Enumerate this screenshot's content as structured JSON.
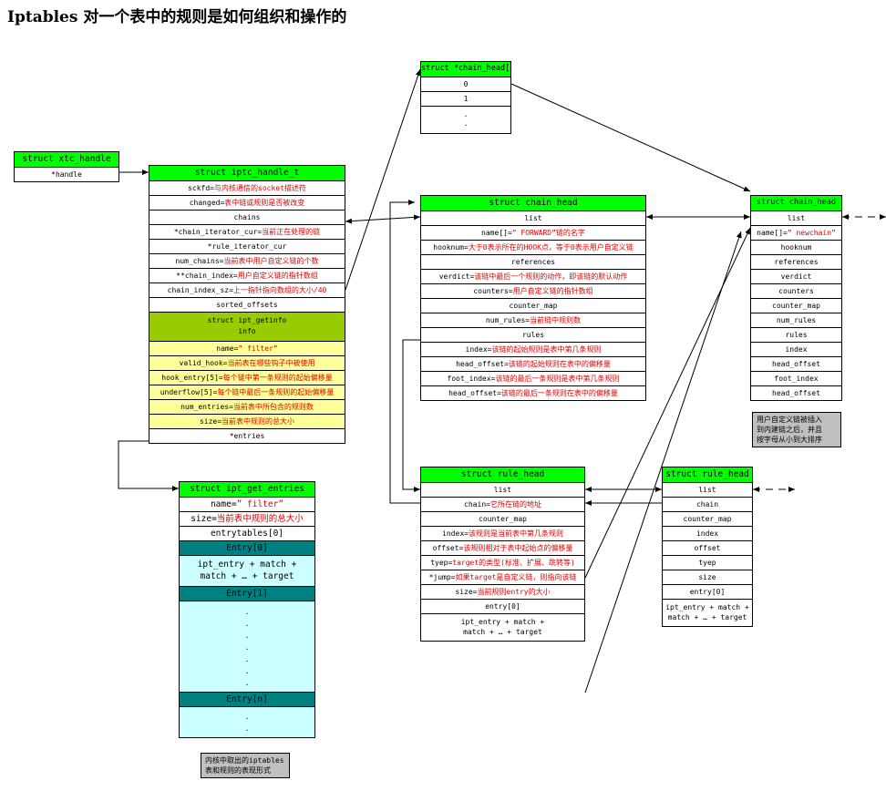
{
  "title": "Iptables 对一个表中的规则是如何组织和操作的",
  "xtc_handle": {
    "header": "struct xtc_handle",
    "rows": [
      "*handle"
    ]
  },
  "iptc_handle": {
    "header": "struct iptc_handle_t",
    "rows": [
      {
        "name": "sckfd=",
        "desc": "与内核通信的socket描述符"
      },
      {
        "name": "changed=",
        "desc": "表中链或规则是否被改变"
      },
      {
        "name": "chains",
        "desc": ""
      },
      {
        "name": "*chain_iterator_cur=",
        "desc": "当前正在处理的链"
      },
      {
        "name": "*rule_iterator_cur",
        "desc": ""
      },
      {
        "name": "num_chains=",
        "desc": "当前表中用户自定义链的个数"
      },
      {
        "name": "**chain_index=",
        "desc": "用户自定义链的指针数组"
      },
      {
        "name": "chain_index_sz=",
        "desc": "上一指针指向数组的大小/40"
      },
      {
        "name": "sorted_offsets",
        "desc": ""
      }
    ],
    "info_label": "struct ipt_getinfo\ninfo",
    "info_rows": [
      {
        "name": "name=",
        "desc": "” filter”"
      },
      {
        "name": "valid_hook=",
        "desc": "当前表在哪些钩子中被使用"
      },
      {
        "name": "hook_entry[5]=",
        "desc": "每个链中第一条规则的起始偏移量"
      },
      {
        "name": "underflow[5]=",
        "desc": "每个链中最后一条规则的起始偏移量"
      },
      {
        "name": "num_entries=",
        "desc": "当前表中所包含的规则数"
      },
      {
        "name": "size=",
        "desc": "当前表中规则的总大小"
      }
    ],
    "last_row": "*entries"
  },
  "chain_head_ptr": {
    "header": "struct *chain_head[]",
    "rows": [
      "0",
      "1",
      ".\n."
    ]
  },
  "chain_head_main": {
    "header": "struct chain_head",
    "rows": [
      {
        "name": "list",
        "desc": ""
      },
      {
        "name": "name[]=",
        "desc": "” FORWARD”链的名字"
      },
      {
        "name": "hooknum=",
        "desc": "大于0表示所在的HOOK点，等于0表示用户自定义链"
      },
      {
        "name": "references",
        "desc": ""
      },
      {
        "name": "verdict=",
        "desc": "该链中最后一个规则的动作，即该链的默认动作"
      },
      {
        "name": "counters=",
        "desc": "用户自定义链的指针数组"
      },
      {
        "name": "counter_map",
        "desc": ""
      },
      {
        "name": "num_rules=",
        "desc": "当前链中规则数"
      },
      {
        "name": "rules",
        "desc": ""
      },
      {
        "name": "index=",
        "desc": "该链的起始规则是表中第几条规则"
      },
      {
        "name": "head_offset=",
        "desc": "该链的起始规则在表中的偏移量"
      },
      {
        "name": "foot_index=",
        "desc": "该链的最后一条规则是表中第几条规则"
      },
      {
        "name": "head_offset=",
        "desc": "该链的最后一条规则在表中的偏移量"
      }
    ]
  },
  "chain_head_right": {
    "header": "struct chain_head",
    "rows": [
      {
        "name": "list",
        "desc": ""
      },
      {
        "name": "name[]=",
        "desc": "” newchain”"
      },
      {
        "name": "hooknum",
        "desc": ""
      },
      {
        "name": "references",
        "desc": ""
      },
      {
        "name": "verdict",
        "desc": ""
      },
      {
        "name": "counters",
        "desc": ""
      },
      {
        "name": "counter_map",
        "desc": ""
      },
      {
        "name": "num_rules",
        "desc": ""
      },
      {
        "name": "rules",
        "desc": ""
      },
      {
        "name": "index",
        "desc": ""
      },
      {
        "name": "head_offset",
        "desc": ""
      },
      {
        "name": "foot_index",
        "desc": ""
      },
      {
        "name": "head_offset",
        "desc": ""
      }
    ],
    "note": "用户自定义链被插入\n到内建链之后，并且\n按字母从小到大排序"
  },
  "rule_head_main": {
    "header": "struct rule_head",
    "rows": [
      {
        "name": "list",
        "desc": ""
      },
      {
        "name": "chain=",
        "desc": "它所在链的地址"
      },
      {
        "name": "counter_map",
        "desc": ""
      },
      {
        "name": "index=",
        "desc": "该规则是当前表中第几条规则"
      },
      {
        "name": "offset=",
        "desc": "该规则相对于表中起始点的偏移量"
      },
      {
        "name": "tyep=",
        "desc": "target的类型(标准、扩展、跳转等)"
      },
      {
        "name": "*jump=",
        "desc": "如果target是自定义链，则指向该链"
      },
      {
        "name": "size=",
        "desc": "当前规则entry的大小"
      },
      {
        "name": "entry[0]",
        "desc": ""
      }
    ],
    "tail": "ipt_entry + match +\nmatch + … + target"
  },
  "rule_head_right": {
    "header": "struct rule_head",
    "rows": [
      "list",
      "chain",
      "counter_map",
      "index",
      "offset",
      "tyep",
      "size",
      "entry[0]"
    ],
    "tail": "ipt_entry + match +\nmatch + … + target"
  },
  "ipt_get_entries": {
    "header": "struct ipt_get_entries",
    "rows": [
      {
        "name": "name=",
        "desc": "” filter”"
      },
      {
        "name": "size=",
        "desc": "当前表中规则的总大小"
      },
      {
        "name": "entrytables[0]",
        "desc": ""
      }
    ],
    "entry0": "Entry[0]",
    "entry0_body": "ipt_entry + match +\nmatch + … + target",
    "entry1": "Entry[1]",
    "entry1_body": ".\n.\n.\n.\n.\n.\n.",
    "entryn": "Entry[n]",
    "entryn_body": ".\n.",
    "note": "内核中取出的iptables\n表和规则的表现形式"
  }
}
